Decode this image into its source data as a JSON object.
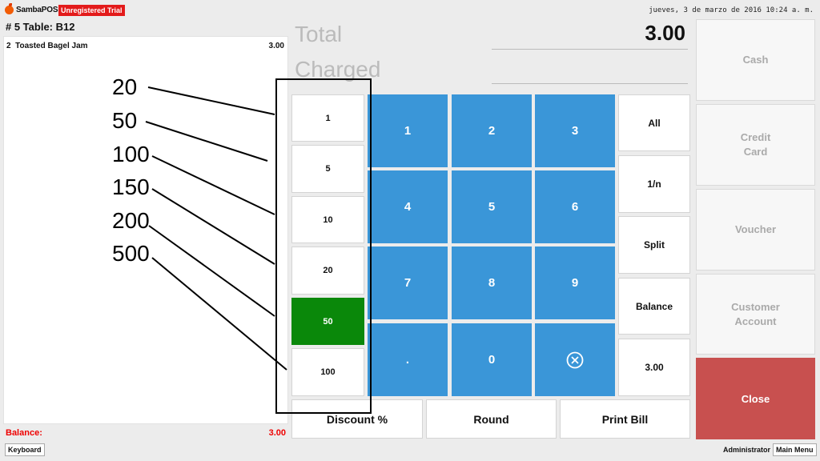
{
  "app": {
    "logo_text": "SambaPOS",
    "trial_badge": "Unregistered Trial",
    "datetime": "jueves, 3 de marzo de 2016 10:24 a. m."
  },
  "ticket": {
    "title": "# 5 Table: B12",
    "orders": [
      {
        "qty": "2",
        "name": "Toasted Bagel Jam",
        "price": "3.00"
      }
    ],
    "balance_label": "Balance:",
    "balance_value": "3.00"
  },
  "footer": {
    "keyboard_label": "Keyboard",
    "user": "Administrator",
    "main_menu_label": "Main Menu"
  },
  "totals": {
    "total_label": "Total",
    "charged_label": "Charged",
    "total_value": "3.00"
  },
  "tender_buttons": [
    "1",
    "5",
    "10",
    "20",
    "50",
    "100"
  ],
  "tender_selected": "50",
  "numpad": [
    "1",
    "2",
    "3",
    "4",
    "5",
    "6",
    "7",
    "8",
    "9",
    ".",
    "0"
  ],
  "aux_buttons": [
    "All",
    "1/n",
    "Split",
    "Balance",
    "3.00"
  ],
  "bottom_buttons": [
    "Discount %",
    "Round",
    "Print Bill"
  ],
  "payment_buttons": [
    "Cash",
    "Credit\nCard",
    "Voucher",
    "Customer\nAccount"
  ],
  "close_label": "Close",
  "annotation": {
    "numbers": [
      "20",
      "50",
      "100",
      "150",
      "200",
      "500"
    ]
  },
  "colors": {
    "numpad_blue": "#3a96d8",
    "selected_green": "#0a880a",
    "close_red": "#c8504f",
    "balance_red": "#e00000",
    "trial_red": "#e31b1b"
  }
}
